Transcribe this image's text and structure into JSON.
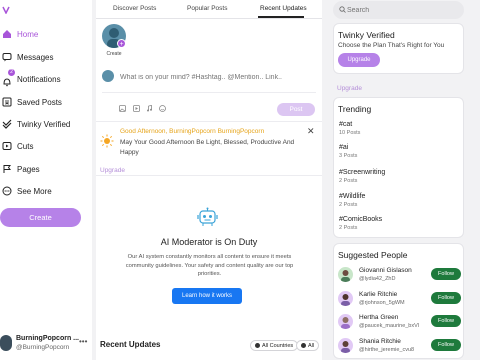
{
  "colors": {
    "accent": "#a855d9",
    "accent_light": "#b682e8",
    "follow_green": "#1e7a3c",
    "primary_blue": "#1877f2",
    "greeting_orange": "#e6a41a"
  },
  "nav": [
    {
      "label": "Home",
      "icon": "home-icon",
      "active": true
    },
    {
      "label": "Messages",
      "icon": "messages-icon"
    },
    {
      "label": "Notifications",
      "icon": "bell-icon",
      "badge": "2"
    },
    {
      "label": "Saved Posts",
      "icon": "bookmark-icon"
    },
    {
      "label": "Twinky Verified",
      "icon": "verified-icon"
    },
    {
      "label": "Cuts",
      "icon": "video-icon"
    },
    {
      "label": "Pages",
      "icon": "flag-icon"
    },
    {
      "label": "See More",
      "icon": "more-icon"
    }
  ],
  "create_label": "Create",
  "profile": {
    "name": "BurningPopcorn ...",
    "handle": "@BurningPopcorn",
    "more": "•••"
  },
  "tabs": [
    "Discover Posts",
    "Popular Posts",
    "Recent Updates"
  ],
  "story": {
    "caption": "Create"
  },
  "composer": {
    "placeholder": "What is on your mind? #Hashtag.. @Mention.. Link..",
    "post_label": "Post"
  },
  "greeting": {
    "title": "Good Afternoon, BurningPopcorn BurningPopcorn",
    "text": "May Your Good Afternoon Be Light, Blessed, Productive And Happy",
    "close": "✕",
    "upgrade": "Upgrade"
  },
  "moderator": {
    "title": "AI Moderator is On Duty",
    "description": "Our AI system constantly monitors all content to ensure it meets community guidelines. Your safety and content quality are our top priorities.",
    "button": "Learn how it works"
  },
  "recent": {
    "title": "Recent Updates",
    "chip_countries": "All Countries",
    "chip_all": "All"
  },
  "search": {
    "placeholder": "Search"
  },
  "verified_card": {
    "title": "Twinky Verified",
    "subtitle": "Choose the Plan That's Right for You",
    "button": "Upgrade",
    "link": "Upgrade"
  },
  "trending": {
    "title": "Trending",
    "items": [
      {
        "tag": "#cat",
        "count": "10 Posts"
      },
      {
        "tag": "#ai",
        "count": "3 Posts"
      },
      {
        "tag": "#Screenwriting",
        "count": "2 Posts"
      },
      {
        "tag": "#Wildlife",
        "count": "2 Posts"
      },
      {
        "tag": "#ComicBooks",
        "count": "2 Posts"
      }
    ]
  },
  "suggested": {
    "title": "Suggested People",
    "follow_label": "Follow",
    "people": [
      {
        "name": "Giovanni Gislason",
        "handle": "@lydia42_ZhD"
      },
      {
        "name": "Karlie Ritchie",
        "handle": "@rjohnson_5gWM"
      },
      {
        "name": "Hertha Green",
        "handle": "@paucek_maurine_bxVl"
      },
      {
        "name": "Shania Ritchie",
        "handle": "@hirthe_jeremie_cvu8"
      }
    ]
  }
}
